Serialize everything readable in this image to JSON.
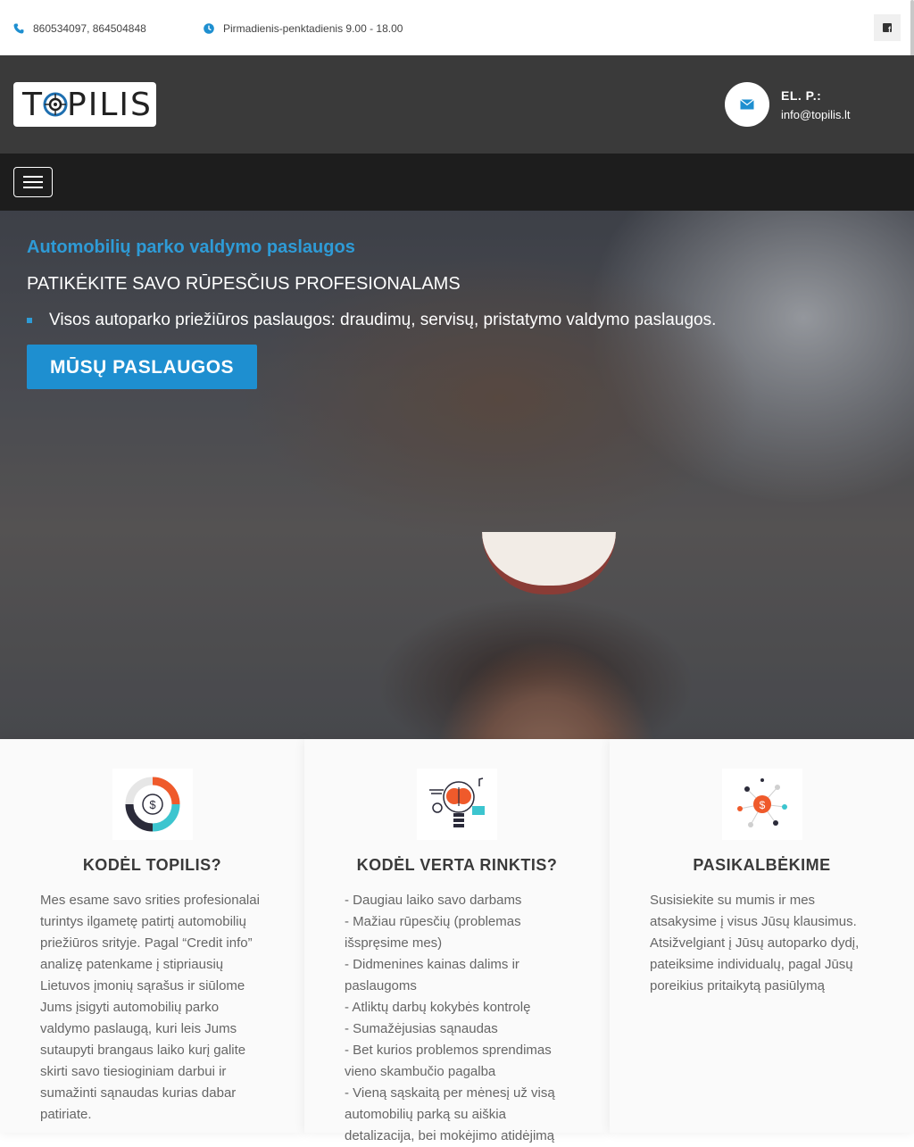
{
  "topbar": {
    "phone": "860534097, 864504848",
    "hours": "Pirmadienis-penktadienis 9.00 - 18.00",
    "icons": {
      "phone": "phone-icon",
      "hours": "clock-icon",
      "social": "facebook-icon"
    }
  },
  "header": {
    "logo_text_left": "T",
    "logo_text_right": "PILIS",
    "email_label": "EL. P.:",
    "email_value": "info@topilis.lt"
  },
  "hero": {
    "subtitle": "Automobilių parko valdymo paslaugos",
    "title": "PATIKĖKITE SAVO RŪPESČIUS PROFESIONALAMS",
    "bullet": "Visos autoparko priežiūros paslaugos: draudimų, servisų, pristatymo valdymo paslaugos.",
    "button": "MŪSŲ PASLAUGOS"
  },
  "cards": [
    {
      "title": "KODĖL TOPILIS?",
      "icon": "money-chart-icon",
      "text": "Mes esame savo srities profesionalai turintys ilgametę patirtį automobilių priežiūros srityje. Pagal “Credit info” analizę patenkame į stipriausių Lietuvos įmonių sąrašus ir siūlome Jums įsigyti automobilių parko valdymo paslaugą, kuri leis Jums sutaupyti brangaus laiko kurį galite skirti savo tiesioginiam darbui ir sumažinti sąnaudas kurias dabar patiriate."
    },
    {
      "title": "KODĖL VERTA RINKTIS?",
      "icon": "brain-bulb-icon",
      "items": [
        "- Daugiau laiko savo darbams",
        "- Mažiau rūpesčių (problemas išspręsime mes)",
        "- Didmenines kainas dalims ir paslaugoms",
        "- Atliktų darbų kokybės kontrolę",
        "- Sumažėjusias sąnaudas",
        "- Bet kurios problemos sprendimas vieno skambučio pagalba",
        "- Vieną sąskaitą per mėnesį už visą automobilių parką su aiškia detalizacija, bei mokėjimo atidėjimą"
      ]
    },
    {
      "title": "PASIKALBĖKIME",
      "icon": "money-network-icon",
      "text": "Susisiekite su mumis ir mes atsakysime į visus Jūsų klausimus. Atsižvelgiant į Jūsų autoparko dydį, pateiksime individualų, pagal Jūsų poreikius pritaikytą pasiūlymą"
    }
  ]
}
